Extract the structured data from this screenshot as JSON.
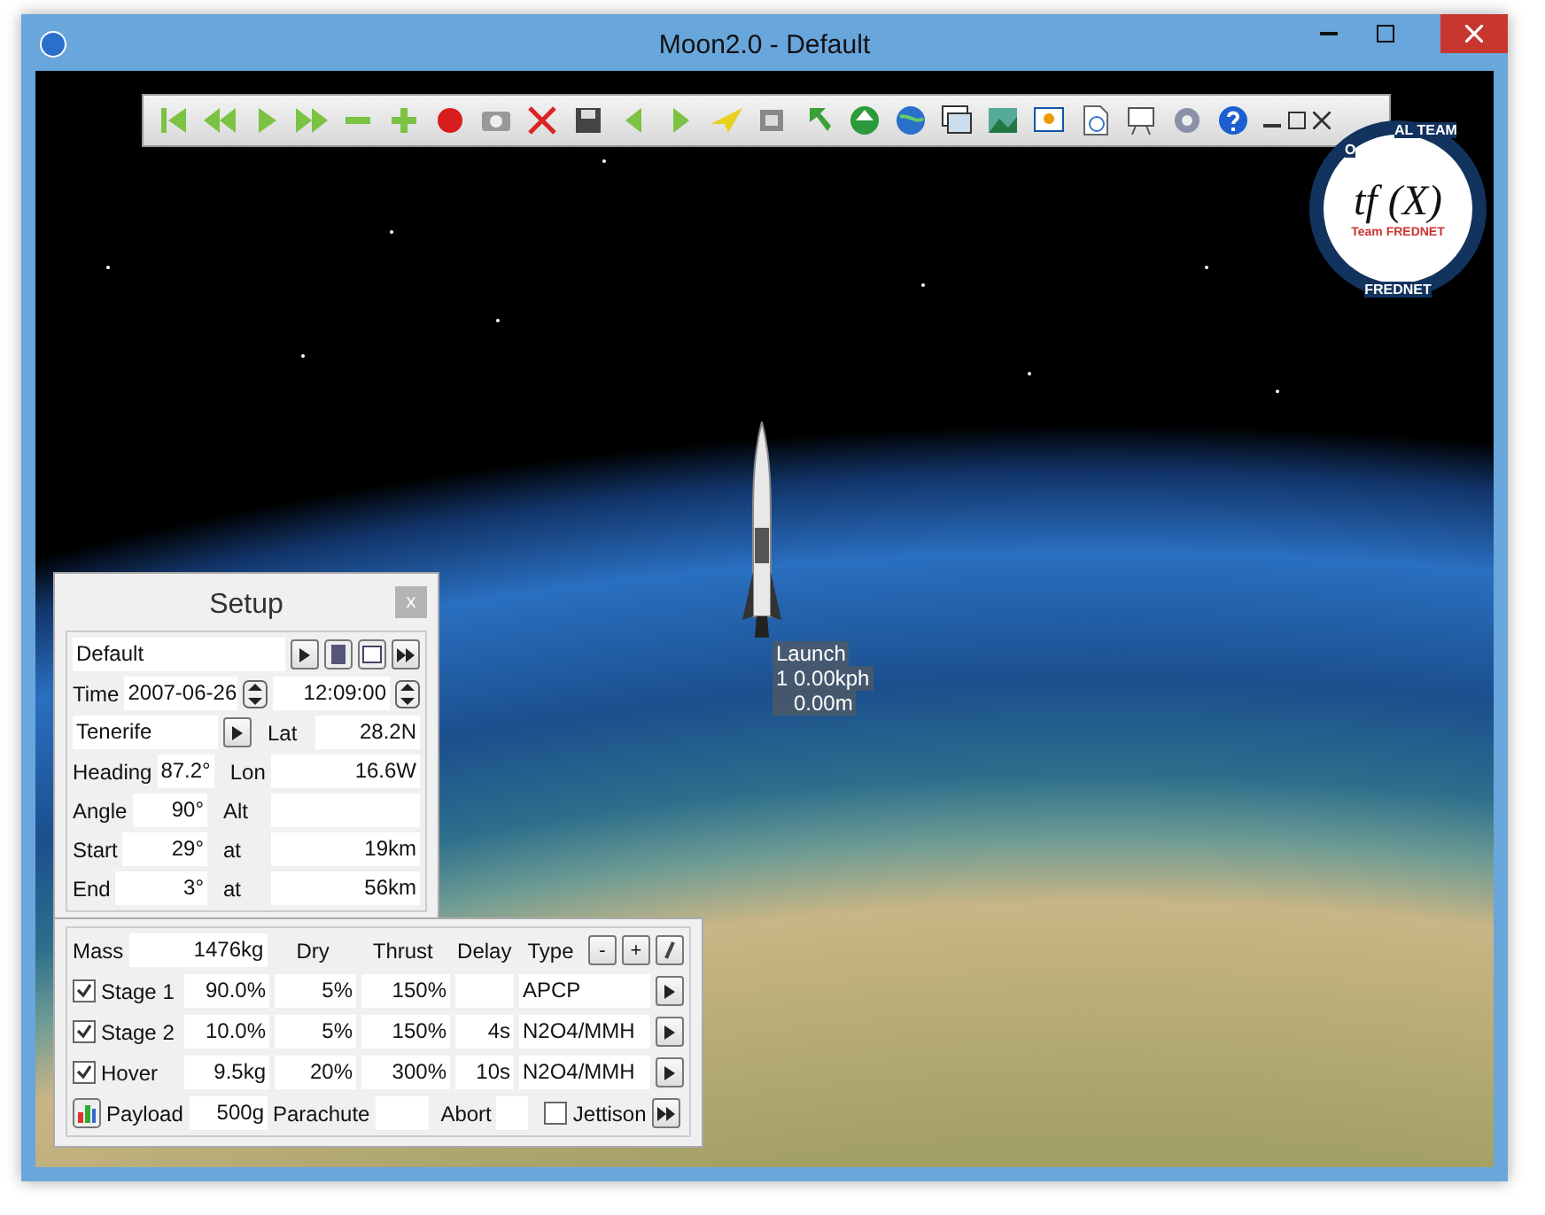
{
  "window": {
    "title": "Moon2.0 - Default"
  },
  "logo": {
    "arc_left": "O",
    "arc_right": "AL TEAM",
    "formula": "tf (X)",
    "team": "Team FREDNET",
    "bottom": "FREDNET"
  },
  "marker": {
    "name": "Launch",
    "speed": "1  0.00kph",
    "altitude": "0.00m"
  },
  "setup": {
    "title": "Setup",
    "close": "x",
    "preset": "Default",
    "time": {
      "label": "Time",
      "date": "2007-06-26",
      "clock": "12:09:00"
    },
    "site": {
      "value": "Tenerife",
      "right_label": "Lat",
      "right_value": "28.2N"
    },
    "pairs": [
      {
        "left_label": "Heading",
        "left_value": "87.2°",
        "right_label": "Lon",
        "right_value": "16.6W"
      },
      {
        "left_label": "Angle",
        "left_value": "90°",
        "right_label": "Alt"
      },
      {
        "left_label": "Start",
        "left_value": "29°",
        "right_label": "at",
        "right_value": "19km"
      },
      {
        "left_label": "End",
        "left_value": "3°",
        "right_label": "at",
        "right_value": "56km"
      }
    ]
  },
  "stages": {
    "mass_label": "Mass",
    "mass": "1476kg",
    "columns": [
      "Dry",
      "Thrust",
      "Delay",
      "Type"
    ],
    "buttons": [
      "-",
      "+"
    ],
    "rows": [
      {
        "name": "Stage 1",
        "checked": true,
        "share": "90.0%",
        "dry": "5%",
        "thrust": "150%",
        "type": "APCP"
      },
      {
        "name": "Stage 2",
        "checked": true,
        "share": "10.0%",
        "dry": "5%",
        "thrust": "150%",
        "delay": "4s",
        "type": "N2O4/MMH"
      },
      {
        "name": "Hover",
        "checked": true,
        "share": "9.5kg",
        "dry": "20%",
        "thrust": "300%",
        "delay": "10s",
        "type": "N2O4/MMH"
      }
    ],
    "payload_label": "Payload",
    "payload": "500g",
    "parachute_label": "Parachute",
    "abort_label": "Abort",
    "jettison": {
      "label": "Jettison",
      "checked": false
    }
  }
}
